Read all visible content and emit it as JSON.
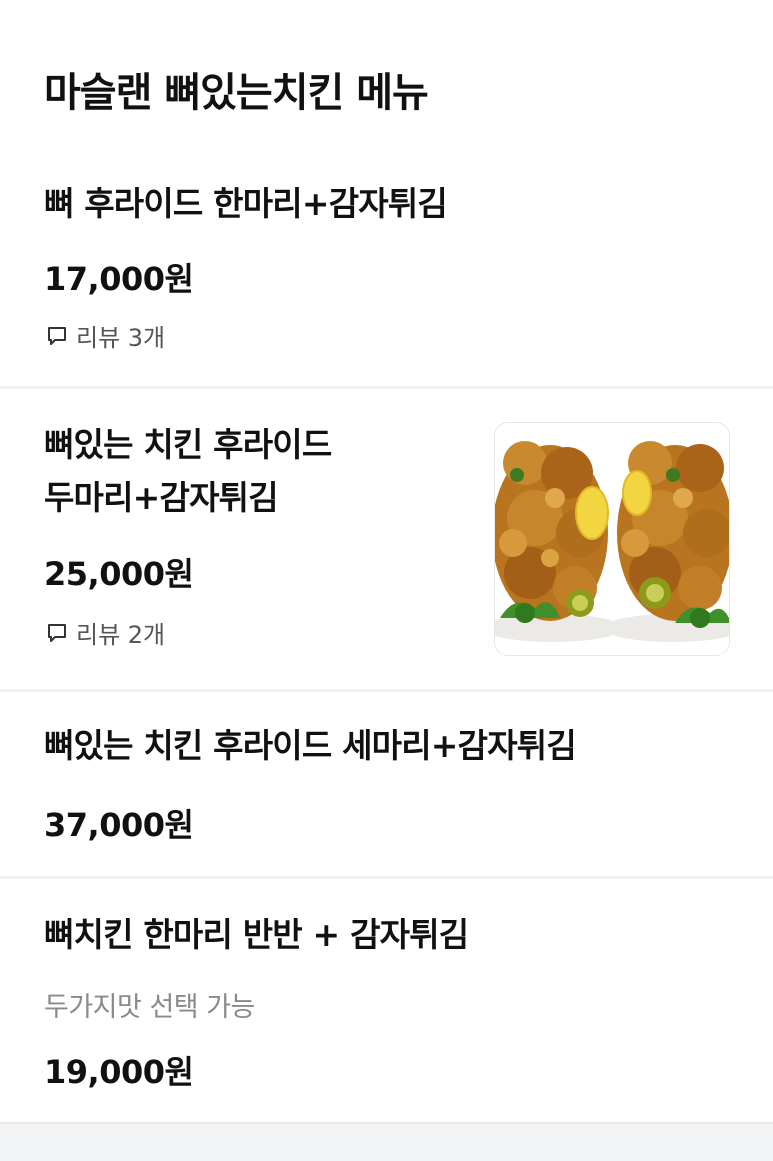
{
  "section": {
    "title": "마슬랜 뼈있는치킨 메뉴"
  },
  "items": [
    {
      "name_lines": [
        "뼈 후라이드 한마리+감자튀김"
      ],
      "price": "17,000원",
      "review": "리뷰 3개"
    },
    {
      "name_lines": [
        "뼈있는 치킨 후라이드",
        "두마리+감자튀김"
      ],
      "price": "25,000원",
      "review": "리뷰 2개",
      "image": "fried-chicken-photo"
    },
    {
      "name_lines": [
        "뼈있는 치킨 후라이드 세마리+감자튀김"
      ],
      "price": "37,000원"
    },
    {
      "name_lines": [
        "뼈치킨 한마리 반반 + 감자튀김"
      ],
      "description": "두가지맛 선택 가능",
      "price": "19,000원"
    }
  ],
  "icons": {
    "review": "speech-bubble-icon"
  }
}
